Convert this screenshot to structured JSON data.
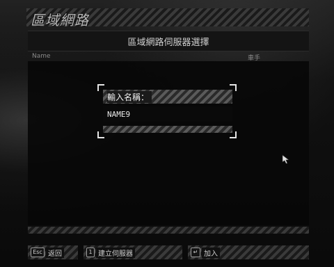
{
  "title": "區域網路",
  "header": "區域網路伺服器選擇",
  "columns": {
    "name": "Name",
    "player": "車手"
  },
  "dialog": {
    "prompt": "輸入名稱：",
    "input_value": "NAME9"
  },
  "footer": {
    "back_key": "Esc",
    "back_label": "返回",
    "create_key": "1",
    "create_label": "建立伺服器",
    "join_key": "↵",
    "join_label": "加入"
  },
  "colors": {
    "background": "#0b0b0b",
    "text": "#d8d8d8",
    "hatch": "#3a3a3a"
  }
}
